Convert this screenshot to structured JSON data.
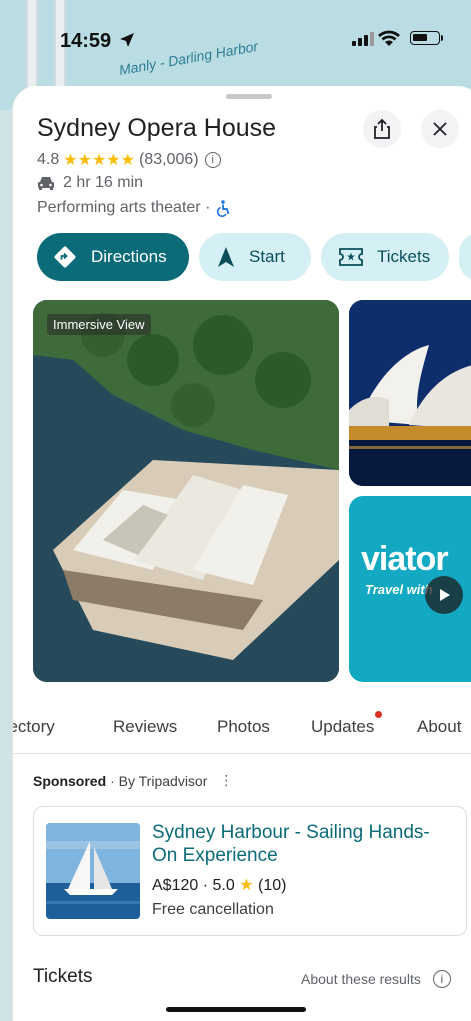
{
  "status_bar": {
    "time": "14:59"
  },
  "map": {
    "label": "Manly - Darling Harbor"
  },
  "place": {
    "name": "Sydney Opera House",
    "rating": "4.8",
    "stars": "★★★★★",
    "review_count": "(83,006)",
    "drive_time": "2 hr 16 min",
    "category": "Performing arts theater ·"
  },
  "actions": {
    "directions": "Directions",
    "start": "Start",
    "tickets": "Tickets"
  },
  "photos": {
    "immersive_label": "Immersive View",
    "viator_logo": "viator",
    "viator_tagline": "Travel with"
  },
  "tabs": [
    "irectory",
    "Reviews",
    "Photos",
    "Updates",
    "About"
  ],
  "sponsored": {
    "label": "Sponsored",
    "by": "· By Tripadvisor"
  },
  "ad": {
    "title": "Sydney Harbour - Sailing Hands-On Experience",
    "price": "A$120 · 5.0",
    "review_count": "(10)",
    "cancellation": "Free cancellation"
  },
  "tickets_section": {
    "title": "Tickets",
    "about_results": "About these results"
  },
  "colors": {
    "primary": "#0b6b78",
    "chip_secondary": "#d4f0f4",
    "star": "#fbbc04",
    "link": "#0b6b78"
  }
}
